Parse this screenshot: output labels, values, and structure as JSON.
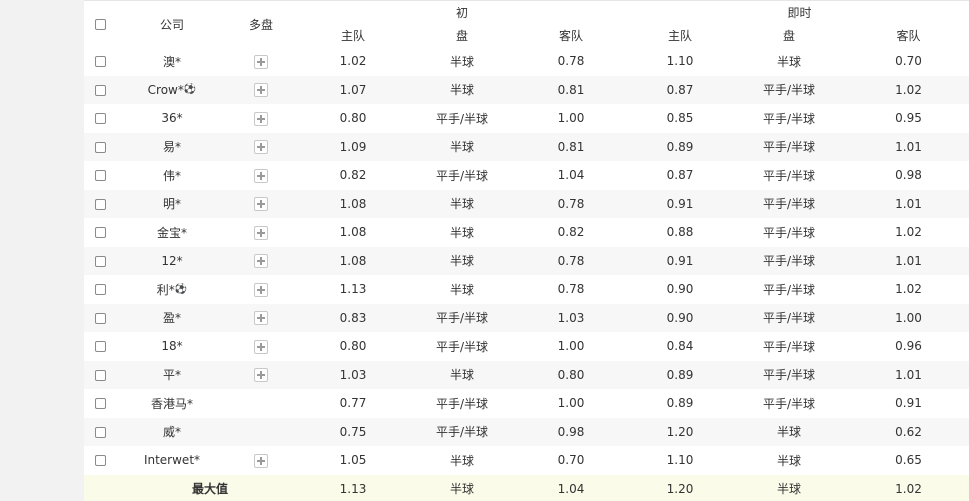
{
  "header": {
    "company": "公司",
    "multi": "多盘",
    "initial_group": "初",
    "live_group": "即时",
    "home": "主队",
    "line": "盘",
    "away": "客队"
  },
  "icons": {
    "checkbox": "checkbox-icon",
    "expand": "plus-icon",
    "ball": "soccer-ball-icon"
  },
  "rows": [
    {
      "company": "澳*",
      "ball": false,
      "expand": true,
      "init_home": "1.02",
      "init_line": "半球",
      "init_away": "0.78",
      "live_home": "1.10",
      "live_line": "半球",
      "live_away": "0.70"
    },
    {
      "company": "Crow*",
      "ball": true,
      "expand": true,
      "init_home": "1.07",
      "init_line": "半球",
      "init_away": "0.81",
      "live_home": "0.87",
      "live_line": "平手/半球",
      "live_away": "1.02"
    },
    {
      "company": "36*",
      "ball": false,
      "expand": true,
      "init_home": "0.80",
      "init_line": "平手/半球",
      "init_away": "1.00",
      "live_home": "0.85",
      "live_line": "平手/半球",
      "live_away": "0.95"
    },
    {
      "company": "易*",
      "ball": false,
      "expand": true,
      "init_home": "1.09",
      "init_line": "半球",
      "init_away": "0.81",
      "live_home": "0.89",
      "live_line": "平手/半球",
      "live_away": "1.01"
    },
    {
      "company": "伟*",
      "ball": false,
      "expand": true,
      "init_home": "0.82",
      "init_line": "平手/半球",
      "init_away": "1.04",
      "live_home": "0.87",
      "live_line": "平手/半球",
      "live_away": "0.98"
    },
    {
      "company": "明*",
      "ball": false,
      "expand": true,
      "init_home": "1.08",
      "init_line": "半球",
      "init_away": "0.78",
      "live_home": "0.91",
      "live_line": "平手/半球",
      "live_away": "1.01"
    },
    {
      "company": "金宝*",
      "ball": false,
      "expand": true,
      "init_home": "1.08",
      "init_line": "半球",
      "init_away": "0.82",
      "live_home": "0.88",
      "live_line": "平手/半球",
      "live_away": "1.02"
    },
    {
      "company": "12*",
      "ball": false,
      "expand": true,
      "init_home": "1.08",
      "init_line": "半球",
      "init_away": "0.78",
      "live_home": "0.91",
      "live_line": "平手/半球",
      "live_away": "1.01"
    },
    {
      "company": "利*",
      "ball": true,
      "expand": true,
      "init_home": "1.13",
      "init_line": "半球",
      "init_away": "0.78",
      "live_home": "0.90",
      "live_line": "平手/半球",
      "live_away": "1.02"
    },
    {
      "company": "盈*",
      "ball": false,
      "expand": true,
      "init_home": "0.83",
      "init_line": "平手/半球",
      "init_away": "1.03",
      "live_home": "0.90",
      "live_line": "平手/半球",
      "live_away": "1.00"
    },
    {
      "company": "18*",
      "ball": false,
      "expand": true,
      "init_home": "0.80",
      "init_line": "平手/半球",
      "init_away": "1.00",
      "live_home": "0.84",
      "live_line": "平手/半球",
      "live_away": "0.96"
    },
    {
      "company": "平*",
      "ball": false,
      "expand": true,
      "init_home": "1.03",
      "init_line": "半球",
      "init_away": "0.80",
      "live_home": "0.89",
      "live_line": "平手/半球",
      "live_away": "1.01"
    },
    {
      "company": "香港马*",
      "ball": false,
      "expand": false,
      "init_home": "0.77",
      "init_line": "平手/半球",
      "init_away": "1.00",
      "live_home": "0.89",
      "live_line": "平手/半球",
      "live_away": "0.91"
    },
    {
      "company": "威*",
      "ball": false,
      "expand": false,
      "init_home": "0.75",
      "init_line": "平手/半球",
      "init_away": "0.98",
      "live_home": "1.20",
      "live_line": "半球",
      "live_away": "0.62"
    },
    {
      "company": "Interwet*",
      "ball": false,
      "expand": true,
      "init_home": "1.05",
      "init_line": "半球",
      "init_away": "0.70",
      "live_home": "1.10",
      "live_line": "半球",
      "live_away": "0.65"
    }
  ],
  "max_row": {
    "label": "最大值",
    "init_home": "1.13",
    "init_line": "半球",
    "init_away": "1.04",
    "live_home": "1.20",
    "live_line": "半球",
    "live_away": "1.02"
  }
}
